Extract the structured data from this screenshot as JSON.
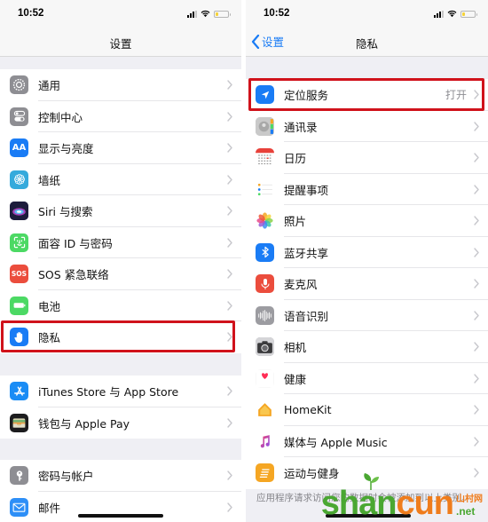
{
  "left_screen": {
    "status_bar": {
      "time": "10:52",
      "battery_level_percent": 20,
      "battery_color": "#f5d33a"
    },
    "nav": {
      "title": "设置"
    },
    "groups": [
      [
        {
          "label": "通用",
          "icon": "gear-icon",
          "color": "#8e8e93"
        },
        {
          "label": "控制中心",
          "icon": "toggles-icon",
          "color": "#8e8e93"
        },
        {
          "label": "显示与亮度",
          "icon": "text-size-icon",
          "icon_text": "AA",
          "color": "#1a7cf5"
        },
        {
          "label": "墙纸",
          "icon": "flower-icon",
          "color": "#35aadc"
        },
        {
          "label": "Siri 与搜索",
          "icon": "siri-icon",
          "color": "#2b2c59"
        },
        {
          "label": "面容 ID 与密码",
          "icon": "face-id-icon",
          "color": "#4cd964"
        },
        {
          "label": "SOS 紧急联络",
          "icon": "sos-icon",
          "icon_text": "SOS",
          "color": "#eb4d3d"
        },
        {
          "label": "电池",
          "icon": "battery-icon",
          "color": "#4cd964"
        },
        {
          "label": "隐私",
          "icon": "hand-icon",
          "color": "#1a7cf5",
          "highlighted": true
        }
      ],
      [
        {
          "label": "iTunes Store 与 App Store",
          "icon": "app-store-icon",
          "color": "#1a8cf5"
        },
        {
          "label": "钱包与 Apple Pay",
          "icon": "wallet-icon",
          "color": "#1c1c1e"
        }
      ],
      [
        {
          "label": "密码与帐户",
          "icon": "key-icon",
          "color": "#8e8e93"
        },
        {
          "label": "邮件",
          "icon": "mail-icon",
          "color": "#2e8ff7"
        }
      ]
    ]
  },
  "right_screen": {
    "status_bar": {
      "time": "10:52",
      "battery_level_percent": 20
    },
    "nav": {
      "back_label": "设置",
      "title": "隐私"
    },
    "items": [
      {
        "label": "定位服务",
        "value": "打开",
        "icon": "location-arrow-icon",
        "color": "#1a7cf5",
        "highlighted": true
      },
      {
        "label": "通讯录",
        "icon": "contacts-icon",
        "color": "#b8b8b8"
      },
      {
        "label": "日历",
        "icon": "calendar-icon",
        "color": "#ffffff"
      },
      {
        "label": "提醒事项",
        "icon": "reminders-icon",
        "color": "#ffffff"
      },
      {
        "label": "照片",
        "icon": "photos-icon",
        "color": "#ffffff"
      },
      {
        "label": "蓝牙共享",
        "icon": "bluetooth-icon",
        "color": "#1a7cf5"
      },
      {
        "label": "麦克风",
        "icon": "microphone-icon",
        "color": "#eb4d3d"
      },
      {
        "label": "语音识别",
        "icon": "waveform-icon",
        "color": "#9c9ca1"
      },
      {
        "label": "相机",
        "icon": "camera-icon",
        "color": "#8e8e93"
      },
      {
        "label": "健康",
        "icon": "heart-icon",
        "color": "#ffffff"
      },
      {
        "label": "HomeKit",
        "icon": "home-icon",
        "color": "#ffffff"
      },
      {
        "label": "媒体与 Apple Music",
        "icon": "music-note-icon",
        "color": "#ffffff"
      },
      {
        "label": "运动与健身",
        "icon": "fitness-icon",
        "color": "#f5a623"
      }
    ],
    "footer": "应用程序请求访问您的数据时会被添加到以上类别。"
  },
  "watermark": {
    "part1": "shan",
    "part2": "cun",
    "cn": "山村网",
    "tld": ".net"
  },
  "accent_color": "#1a7cf5",
  "highlight_color": "#d0121b"
}
